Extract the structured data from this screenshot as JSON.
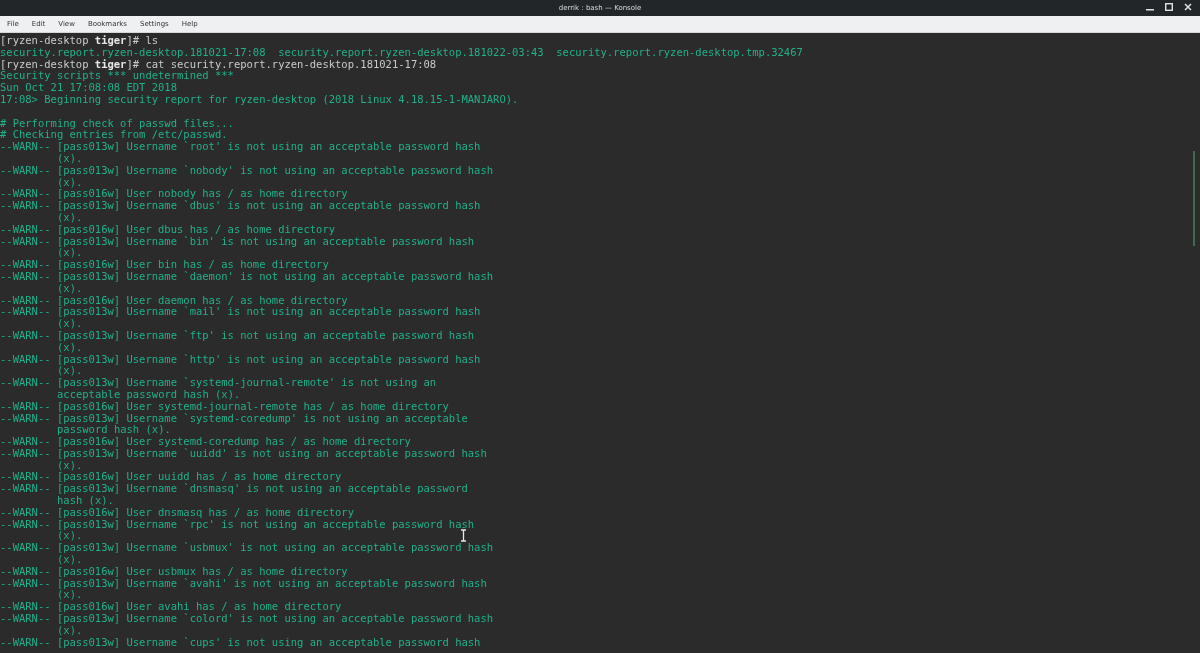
{
  "window": {
    "title": "derrik : bash — Konsole"
  },
  "menu": [
    "File",
    "Edit",
    "View",
    "Bookmarks",
    "Settings",
    "Help"
  ],
  "terminal": {
    "lines": [
      {
        "kind": "prompt",
        "text": "[ryzen-desktop **tiger**]# ls"
      },
      {
        "kind": "output",
        "text": "security.report.ryzen-desktop.181021-17:08  security.report.ryzen-desktop.181022-03:43  security.report.ryzen-desktop.tmp.32467"
      },
      {
        "kind": "prompt",
        "text": "[ryzen-desktop **tiger**]# cat security.report.ryzen-desktop.181021-17:08"
      },
      {
        "kind": "output",
        "text": "Security scripts *** undetermined ***"
      },
      {
        "kind": "output",
        "text": "Sun Oct 21 17:08:08 EDT 2018"
      },
      {
        "kind": "output",
        "text": "17:08> Beginning security report for ryzen-desktop (2018 Linux 4.18.15-1-MANJARO)."
      },
      {
        "kind": "blank"
      },
      {
        "kind": "output",
        "text": "# Performing check of passwd files..."
      },
      {
        "kind": "output",
        "text": "# Checking entries from /etc/passwd."
      },
      {
        "kind": "output",
        "text": "--WARN-- [pass013w] Username `root' is not using an acceptable password hash"
      },
      {
        "kind": "wrap",
        "text": "(x)."
      },
      {
        "kind": "output",
        "text": "--WARN-- [pass013w] Username `nobody' is not using an acceptable password hash"
      },
      {
        "kind": "wrap",
        "text": "(x)."
      },
      {
        "kind": "output",
        "text": "--WARN-- [pass016w] User nobody has / as home directory"
      },
      {
        "kind": "output",
        "text": "--WARN-- [pass013w] Username `dbus' is not using an acceptable password hash"
      },
      {
        "kind": "wrap",
        "text": "(x)."
      },
      {
        "kind": "output",
        "text": "--WARN-- [pass016w] User dbus has / as home directory"
      },
      {
        "kind": "output",
        "text": "--WARN-- [pass013w] Username `bin' is not using an acceptable password hash"
      },
      {
        "kind": "wrap",
        "text": "(x)."
      },
      {
        "kind": "output",
        "text": "--WARN-- [pass016w] User bin has / as home directory"
      },
      {
        "kind": "output",
        "text": "--WARN-- [pass013w] Username `daemon' is not using an acceptable password hash"
      },
      {
        "kind": "wrap",
        "text": "(x)."
      },
      {
        "kind": "output",
        "text": "--WARN-- [pass016w] User daemon has / as home directory"
      },
      {
        "kind": "output",
        "text": "--WARN-- [pass013w] Username `mail' is not using an acceptable password hash"
      },
      {
        "kind": "wrap",
        "text": "(x)."
      },
      {
        "kind": "output",
        "text": "--WARN-- [pass013w] Username `ftp' is not using an acceptable password hash"
      },
      {
        "kind": "wrap",
        "text": "(x)."
      },
      {
        "kind": "output",
        "text": "--WARN-- [pass013w] Username `http' is not using an acceptable password hash"
      },
      {
        "kind": "wrap",
        "text": "(x)."
      },
      {
        "kind": "output",
        "text": "--WARN-- [pass013w] Username `systemd-journal-remote' is not using an"
      },
      {
        "kind": "wrap",
        "text": "acceptable password hash (x)."
      },
      {
        "kind": "output",
        "text": "--WARN-- [pass016w] User systemd-journal-remote has / as home directory"
      },
      {
        "kind": "output",
        "text": "--WARN-- [pass013w] Username `systemd-coredump' is not using an acceptable"
      },
      {
        "kind": "wrap",
        "text": "password hash (x)."
      },
      {
        "kind": "output",
        "text": "--WARN-- [pass016w] User systemd-coredump has / as home directory"
      },
      {
        "kind": "output",
        "text": "--WARN-- [pass013w] Username `uuidd' is not using an acceptable password hash"
      },
      {
        "kind": "wrap",
        "text": "(x)."
      },
      {
        "kind": "output",
        "text": "--WARN-- [pass016w] User uuidd has / as home directory"
      },
      {
        "kind": "output",
        "text": "--WARN-- [pass013w] Username `dnsmasq' is not using an acceptable password"
      },
      {
        "kind": "wrap",
        "text": "hash (x)."
      },
      {
        "kind": "output",
        "text": "--WARN-- [pass016w] User dnsmasq has / as home directory"
      },
      {
        "kind": "output",
        "text": "--WARN-- [pass013w] Username `rpc' is not using an acceptable password hash"
      },
      {
        "kind": "wrap",
        "text": "(x)."
      },
      {
        "kind": "output",
        "text": "--WARN-- [pass013w] Username `usbmux' is not using an acceptable password hash"
      },
      {
        "kind": "wrap",
        "text": "(x)."
      },
      {
        "kind": "output",
        "text": "--WARN-- [pass016w] User usbmux has / as home directory"
      },
      {
        "kind": "output",
        "text": "--WARN-- [pass013w] Username `avahi' is not using an acceptable password hash"
      },
      {
        "kind": "wrap",
        "text": "(x)."
      },
      {
        "kind": "output",
        "text": "--WARN-- [pass016w] User avahi has / as home directory"
      },
      {
        "kind": "output",
        "text": "--WARN-- [pass013w] Username `colord' is not using an acceptable password hash"
      },
      {
        "kind": "wrap",
        "text": "(x)."
      },
      {
        "kind": "output",
        "text": "--WARN-- [pass013w] Username `cups' is not using an acceptable password hash"
      }
    ]
  }
}
